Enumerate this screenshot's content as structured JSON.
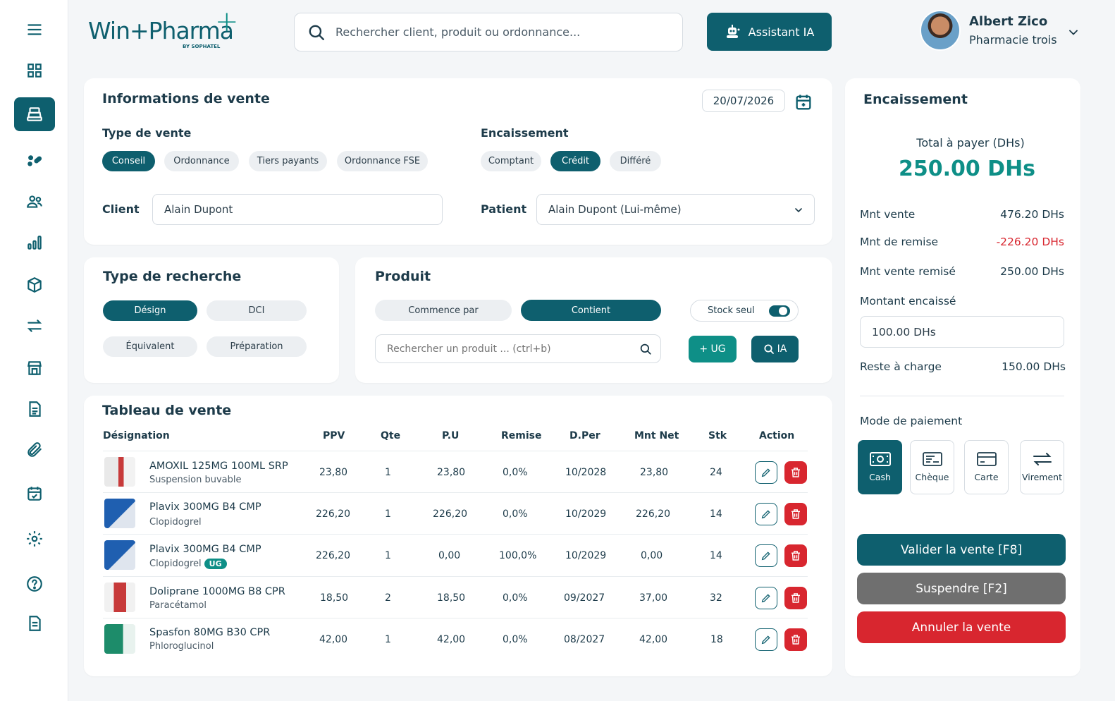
{
  "brand": {
    "logo_text": "Win+Pharma",
    "logo_sub": "BY SOPHATEL"
  },
  "header": {
    "search_placeholder": "Rechercher client, produit ou ordonnance...",
    "ai_button": "Assistant IA",
    "user_name": "Albert Zico",
    "user_org": "Pharmacie trois"
  },
  "vente": {
    "title": "Informations de vente",
    "date": "20/07/2026",
    "type_label": "Type de vente",
    "types": [
      "Conseil",
      "Ordonnance",
      "Tiers payants",
      "Ordonnance FSE"
    ],
    "type_selected": "Conseil",
    "encaissement_label": "Encaissement",
    "encaissements": [
      "Comptant",
      "Crédit",
      "Différé"
    ],
    "encaissement_selected": "Crédit",
    "client_label": "Client",
    "client_value": "Alain Dupont",
    "patient_label": "Patient",
    "patient_value": "Alain Dupont (Lui-même)"
  },
  "recherche": {
    "title": "Type de recherche",
    "options": [
      "Désign",
      "DCI",
      "Équivalent",
      "Préparation"
    ],
    "selected": "Désign"
  },
  "produit": {
    "title": "Produit",
    "modes": [
      "Commence par",
      "Contient"
    ],
    "mode_selected": "Contient",
    "stock_label": "Stock seul",
    "stock_on": true,
    "search_placeholder": "Rechercher un produit ... (ctrl+b)",
    "ug_button": "+ UG",
    "ia_button": "IA"
  },
  "table": {
    "title": "Tableau de vente",
    "headers": [
      "Désignation",
      "PPV",
      "Qte",
      "P.U",
      "Remise",
      "D.Per",
      "Mnt Net",
      "Stk",
      "Action"
    ],
    "rows": [
      {
        "name": "AMOXIL 125MG 100ML SRP",
        "sub": "Suspension buvable",
        "ug": "",
        "ppv": "23,80",
        "qte": "1",
        "pu": "23,80",
        "remise": "0,0%",
        "dper": "10/2028",
        "net": "23,80",
        "stk": "24"
      },
      {
        "name": "Plavix 300MG B4 CMP",
        "sub": "Clopidogrel",
        "ug": "",
        "ppv": "226,20",
        "qte": "1",
        "pu": "226,20",
        "remise": "0,0%",
        "dper": "10/2029",
        "net": "226,20",
        "stk": "14"
      },
      {
        "name": "Plavix 300MG B4 CMP",
        "sub": "Clopidogrel",
        "ug": "UG",
        "ppv": "226,20",
        "qte": "1",
        "pu": "0,00",
        "remise": "100,0%",
        "dper": "10/2029",
        "net": "0,00",
        "stk": "14"
      },
      {
        "name": "Doliprane 1000MG B8 CPR",
        "sub": "Paracétamol",
        "ug": "",
        "ppv": "18,50",
        "qte": "2",
        "pu": "18,50",
        "remise": "0,0%",
        "dper": "09/2027",
        "net": "37,00",
        "stk": "32"
      },
      {
        "name": "Spasfon 80MG B30 CPR",
        "sub": "Phloroglucinol",
        "ug": "",
        "ppv": "42,00",
        "qte": "1",
        "pu": "42,00",
        "remise": "0,0%",
        "dper": "08/2027",
        "net": "42,00",
        "stk": "18"
      }
    ]
  },
  "encaissement": {
    "title": "Encaissement",
    "total_label": "Total à payer (DHs)",
    "total_value": "250.00 DHs",
    "mnt_vente_label": "Mnt vente",
    "mnt_vente": "476.20 DHs",
    "remise_label": "Mnt de remise",
    "remise": "-226.20 DHs",
    "remise_color": "#d8262f",
    "remise_vente_label": "Mnt vente remisé",
    "remise_vente": "250.00 DHs",
    "encaisse_label": "Montant encaissé",
    "encaisse_value": "100.00 DHs",
    "reste_label": "Reste à charge",
    "reste": "150.00 DHs",
    "mode_label": "Mode de paiement",
    "modes": [
      "Cash",
      "Chèque",
      "Carte",
      "Virement"
    ],
    "mode_selected": "Cash",
    "valider": "Valider la vente [F8]",
    "suspendre": "Suspendre [F2]",
    "annuler": "Annuler la vente"
  },
  "colors": {
    "primary": "#0e5f6e",
    "accent": "#0e8f87",
    "danger": "#d8262f",
    "muted": "#6f6f6f"
  }
}
